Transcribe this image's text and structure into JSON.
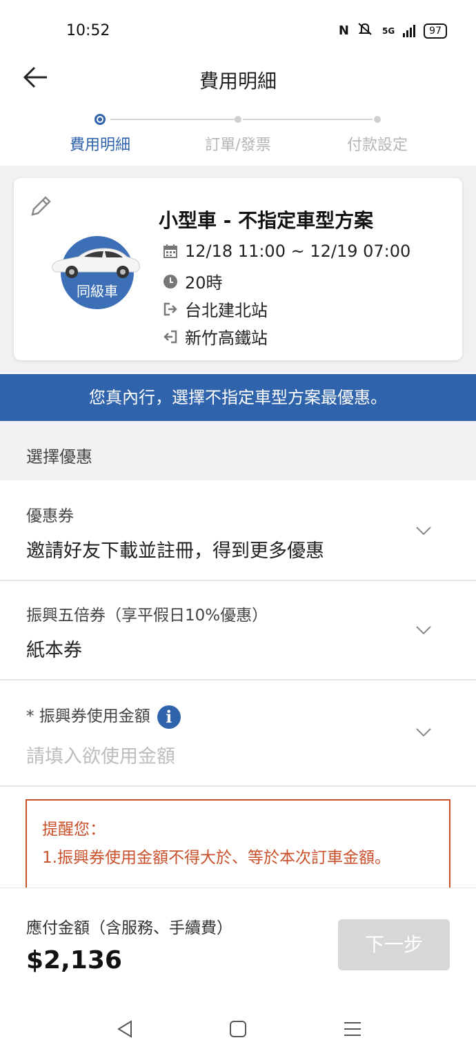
{
  "status_bar": {
    "time": "10:52",
    "network": "5G",
    "battery": "97"
  },
  "header": {
    "title": "費用明細"
  },
  "stepper": {
    "steps": [
      {
        "label": "費用明細",
        "active": true
      },
      {
        "label": "訂單/發票",
        "active": false
      },
      {
        "label": "付款設定",
        "active": false
      }
    ],
    "active_color": "#2f63ab"
  },
  "trip": {
    "badge_label": "同級車",
    "plan_title": "小型車 - 不指定車型方案",
    "datetime": "12/18 11:00 ~ 12/19 07:00",
    "duration": "20時",
    "pickup": "台北建北站",
    "dropoff": "新竹高鐵站"
  },
  "promo_banner": "您真內行，選擇不指定車型方案最優惠。",
  "discount_section": {
    "title": "選擇優惠",
    "coupon": {
      "label": "優惠券",
      "value": "邀請好友下載並註冊，得到更多優惠"
    },
    "stimulus_voucher": {
      "label": "振興五倍券（享平假日10%優惠）",
      "value": "紙本券"
    },
    "voucher_amount": {
      "label": "* 振興券使用金額",
      "placeholder": "請填入欲使用金額",
      "info_icon": "i"
    }
  },
  "reminder": {
    "title": "提醒您：",
    "text": "1.振興券使用金額不得大於、等於本次訂車金額。"
  },
  "footer": {
    "amount_label": "應付金額（含服務、手續費）",
    "amount": "$2,136",
    "next_button": "下一步"
  },
  "colors": {
    "brand_blue": "#2f63ab",
    "warning": "#c9502a",
    "disabled_button": "#d7d7d7"
  }
}
